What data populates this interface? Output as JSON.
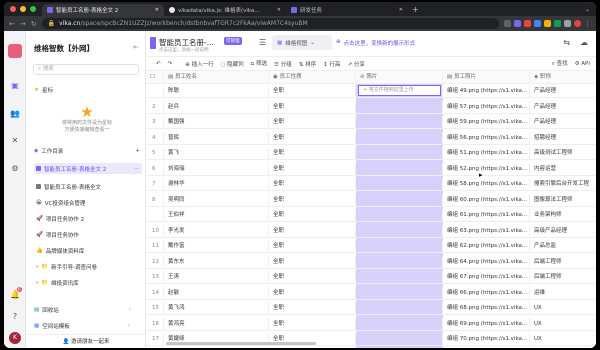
{
  "browser": {
    "tabs": [
      {
        "label": "智能员工名册-表格全文 2",
        "active": true,
        "icon": "vika-icon"
      },
      {
        "label": "vikadata/vika.js: 维格表(vika...",
        "active": false,
        "icon": "github-icon"
      },
      {
        "label": "研发任务",
        "active": false,
        "icon": "vika-icon"
      }
    ],
    "url_host": "vika.cn",
    "url_path": "/space/spcBcZN1UZZJz/workbench/dstbnbvafTGR7c2FkAa/viwAM7C4syuBM"
  },
  "rail": {
    "badge": "6",
    "avatar_letter": "K"
  },
  "tree": {
    "space_title": "维格智数【外网】",
    "search_placeholder": "搜索",
    "star_label": "星标",
    "star_empty": [
      "将常用的文件设为星标",
      "方便快速编辑查看一"
    ],
    "workdir_label": "工作目录",
    "nodes": [
      {
        "label": "智能员工名册-表格全文 2",
        "selected": true,
        "icon": "sheet-icon"
      },
      {
        "label": "智能员工名册-表格全文",
        "selected": false,
        "icon": "sheet-icon"
      },
      {
        "label": "VC投资组合管理",
        "selected": false,
        "icon": "emoji-icon"
      },
      {
        "label": "项目任务协作 2",
        "selected": false,
        "icon": "rocket-icon"
      },
      {
        "label": "项目任务协作",
        "selected": false,
        "icon": "rocket-icon"
      },
      {
        "label": "品牌媒体资料库",
        "selected": false,
        "icon": "thumb-icon"
      },
      {
        "label": "新手引导-调查问卷",
        "selected": false,
        "icon": "folder-icon"
      },
      {
        "label": "维投资讯库",
        "selected": false,
        "icon": "folder-icon"
      }
    ],
    "recycle": "回收站",
    "templates": "空间站模板",
    "invite": "邀请朋友一起来"
  },
  "sheet": {
    "title": "智能员工名册-...",
    "tag": "可管理",
    "description": "点击这里，添加一段说明",
    "view_tab": "维格视图",
    "add_view": "点击这里，变换新的展示形式"
  },
  "toolbar": {
    "insert": "插入一行",
    "hide": "隐藏列",
    "filter": "筛选",
    "group": "分组",
    "sort": "排序",
    "row_height": "行高",
    "share": "分享",
    "find": "查找",
    "api": "API"
  },
  "grid": {
    "columns": [
      "员工姓名",
      "员工性质",
      "照片",
      "员工照片",
      "职称"
    ],
    "upload_hint": "+ 将文件拖到这里上传",
    "rows": [
      {
        "n": "",
        "name": "陈聪",
        "type": "全职",
        "pic": "编组 49.png (https://s1.vika...",
        "title": "产品经理"
      },
      {
        "n": "2",
        "name": "赵兵",
        "type": "全职",
        "pic": "编组 57.png (https://s1.vika...",
        "title": "产品经理"
      },
      {
        "n": "3",
        "name": "戴国强",
        "type": "全职",
        "pic": "编组 59.png (https://s1.vika...",
        "title": "产品经理"
      },
      {
        "n": "4",
        "name": "曾辉",
        "type": "全职",
        "pic": "编组 56.png (https://s1.vika...",
        "title": "招聘经理"
      },
      {
        "n": "5",
        "name": "黄飞",
        "type": "全职",
        "pic": "编组 51.png (https://s1.vika...",
        "title": "高级测试工程师"
      },
      {
        "n": "6",
        "name": "刘海瑞",
        "type": "全职",
        "pic": "编组 52.png (https://s1.vika...",
        "title": "内容运营"
      },
      {
        "n": "7",
        "name": "谢林华",
        "type": "全职",
        "pic": "编组 58.png (https://s1.vika...",
        "title": "搜索引擎后台开发工程"
      },
      {
        "n": "8",
        "name": "吴明同",
        "type": "全职",
        "pic": "编组 60.png (https://s1.vika...",
        "title": "图像算法工程师"
      },
      {
        "n": "",
        "name": "王伯祥",
        "type": "全职",
        "pic": "编组 61.png (https://s1.vika...",
        "title": "业务架构师"
      },
      {
        "n": "10",
        "name": "李光发",
        "type": "全职",
        "pic": "编组 63.png (https://s1.vika...",
        "title": "高级产品经理"
      },
      {
        "n": "11",
        "name": "戴作富",
        "type": "全职",
        "pic": "编组 62.png (https://s1.vika...",
        "title": "产品总监"
      },
      {
        "n": "12",
        "name": "黄东东",
        "type": "全职",
        "pic": "编组 64.png (https://s1.vika...",
        "title": "后端工程师"
      },
      {
        "n": "13",
        "name": "王涛",
        "type": "全职",
        "pic": "编组 67.png (https://s1.vika...",
        "title": "后端工程师"
      },
      {
        "n": "14",
        "name": "赵敏",
        "type": "全职",
        "pic": "编组 66.png (https://s1.vika...",
        "title": "运维"
      },
      {
        "n": "15",
        "name": "黄飞鸿",
        "type": "全职",
        "pic": "编组 68.png (https://s1.vika...",
        "title": "UX"
      },
      {
        "n": "16",
        "name": "黄鸿亮",
        "type": "全职",
        "pic": "编组 69.png (https://s1.vika...",
        "title": "UX"
      },
      {
        "n": "17",
        "name": "黄婕绦",
        "type": "全职",
        "pic": "编组 70.png (https://s1.vika...",
        "title": "UX"
      },
      {
        "n": "18",
        "name": "...",
        "type": "全职",
        "pic": "编组 71.png (https://s1.vika...",
        "title": "..."
      }
    ]
  },
  "colors": {
    "accent": "#7b67ee",
    "photo_column": "#d6d0fb",
    "logo": "#e85f7c"
  }
}
